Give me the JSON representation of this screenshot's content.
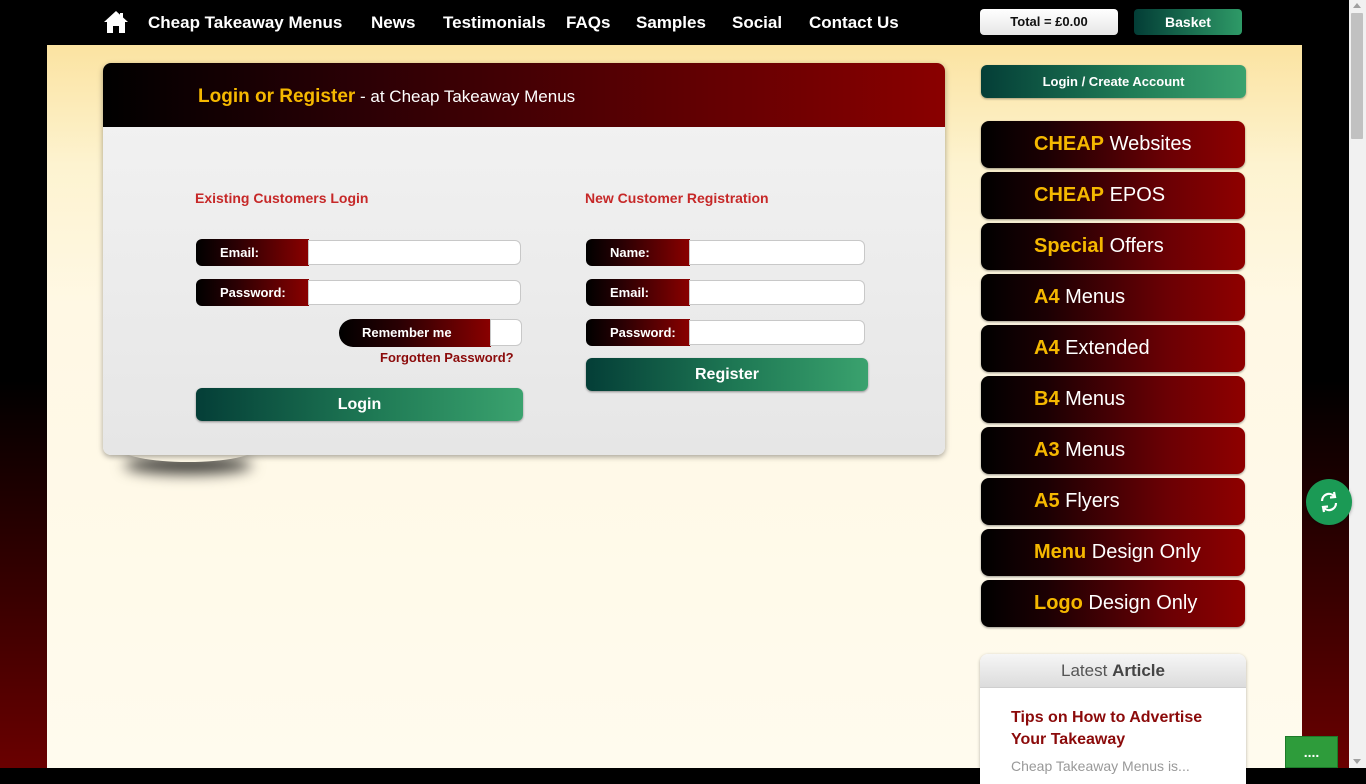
{
  "nav": {
    "home_icon": "home-icon",
    "links": [
      "Cheap Takeaway Menus",
      "News",
      "Testimonials",
      "FAQs",
      "Samples",
      "Social",
      "Contact Us"
    ],
    "total": "Total = £0.00",
    "basket": "Basket"
  },
  "login_panel": {
    "title_strong": "Login or Register",
    "title_rest": " - at Cheap Takeaway Menus",
    "existing": {
      "heading": "Existing Customers Login",
      "email_label": "Email:",
      "email_value": "",
      "password_label": "Password:",
      "password_value": "",
      "remember_label": "Remember me",
      "forgot_link": "Forgotten Password?",
      "login_button": "Login"
    },
    "new_customer": {
      "heading": "New Customer Registration",
      "name_label": "Name:",
      "name_value": "",
      "email_label": "Email:",
      "email_value": "",
      "password_label": "Password:",
      "password_value": "",
      "register_button": "Register"
    }
  },
  "sidebar": {
    "login_create": "Login / Create Account",
    "items": [
      {
        "bold": "CHEAP",
        "rest": " Websites"
      },
      {
        "bold": "CHEAP",
        "rest": " EPOS"
      },
      {
        "bold": "Special",
        "rest": " Offers"
      },
      {
        "bold": "A4",
        "rest": " Menus"
      },
      {
        "bold": "A4",
        "rest": " Extended"
      },
      {
        "bold": "B4",
        "rest": " Menus"
      },
      {
        "bold": "A3",
        "rest": " Menus"
      },
      {
        "bold": "A5",
        "rest": " Flyers"
      },
      {
        "bold": "Menu",
        "rest": " Design Only"
      },
      {
        "bold": "Logo",
        "rest": " Design Only"
      }
    ],
    "article": {
      "header_light": "Latest ",
      "header_bold": "Article",
      "title": "Tips on How to Advertise Your Takeaway",
      "snippet": "Cheap Takeaway Menus is..."
    }
  },
  "floating": {
    "circle_icon": "sync-icon",
    "chat_label": "...."
  },
  "colors": {
    "accent_gold": "#f5b800",
    "brand_red": "#8a0000",
    "button_green": "#2e9a67",
    "heading_red": "#c62828"
  }
}
